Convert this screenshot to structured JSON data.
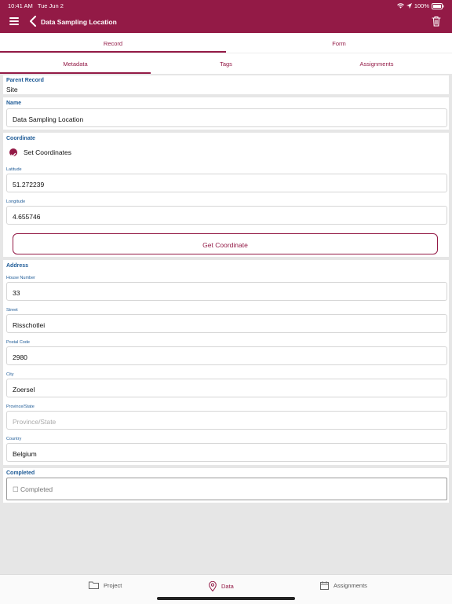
{
  "status": {
    "time": "10:41 AM",
    "date": "Tue Jun 2",
    "battery": "100%"
  },
  "header": {
    "title": "Data Sampling Location"
  },
  "tabs_primary": [
    {
      "label": "Record"
    },
    {
      "label": "Form"
    }
  ],
  "tabs_secondary": [
    {
      "label": "Metadata"
    },
    {
      "label": "Tags"
    },
    {
      "label": "Assignments"
    }
  ],
  "parent": {
    "label": "Parent Record",
    "value": "Site"
  },
  "name": {
    "label": "Name",
    "value": "Data Sampling Location"
  },
  "coordinate": {
    "label": "Coordinate",
    "set_label": "Set Coordinates",
    "latitude_label": "Latitude",
    "latitude": "51.272239",
    "longitude_label": "Longitude",
    "longitude": "4.655746",
    "button": "Get Coordinate"
  },
  "address": {
    "label": "Address",
    "house_number_label": "House Number",
    "house_number": "33",
    "street_label": "Street",
    "street": "Risschotlei",
    "postal_code_label": "Postal Code",
    "postal_code": "2980",
    "city_label": "City",
    "city": "Zoersel",
    "province_label": "Province/State",
    "province_placeholder": "Province/State",
    "country_label": "Country",
    "country": "Belgium"
  },
  "completed": {
    "label": "Completed",
    "checkbox": "☐ Completed"
  },
  "bottom_nav": [
    {
      "label": "Project"
    },
    {
      "label": "Data"
    },
    {
      "label": "Assignments"
    }
  ]
}
